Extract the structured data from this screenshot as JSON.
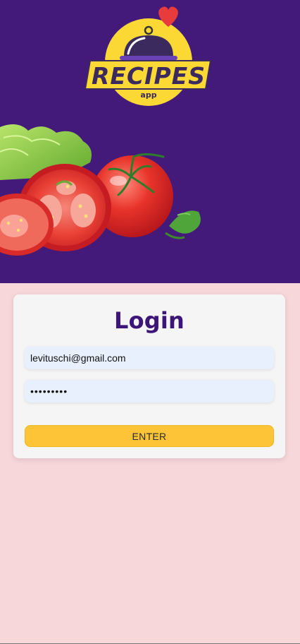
{
  "hero": {
    "logo": {
      "title": "RECIPES",
      "subtitle": "app",
      "icons": [
        "cloche-icon",
        "heart-icon"
      ]
    },
    "illustration": [
      "lettuce-leaves",
      "sliced-tomato",
      "whole-tomato",
      "parsley"
    ]
  },
  "login": {
    "heading": "Login",
    "email_value": "levituschi@gmail.com",
    "password_value": "•••••••••",
    "enter_label": "ENTER"
  },
  "colors": {
    "hero_background": "#431a7a",
    "page_background": "#f8d7da",
    "card_background": "#f5f5f5",
    "heading": "#3d1477",
    "input_background": "#e8f0fd",
    "button": "#fcc436"
  }
}
